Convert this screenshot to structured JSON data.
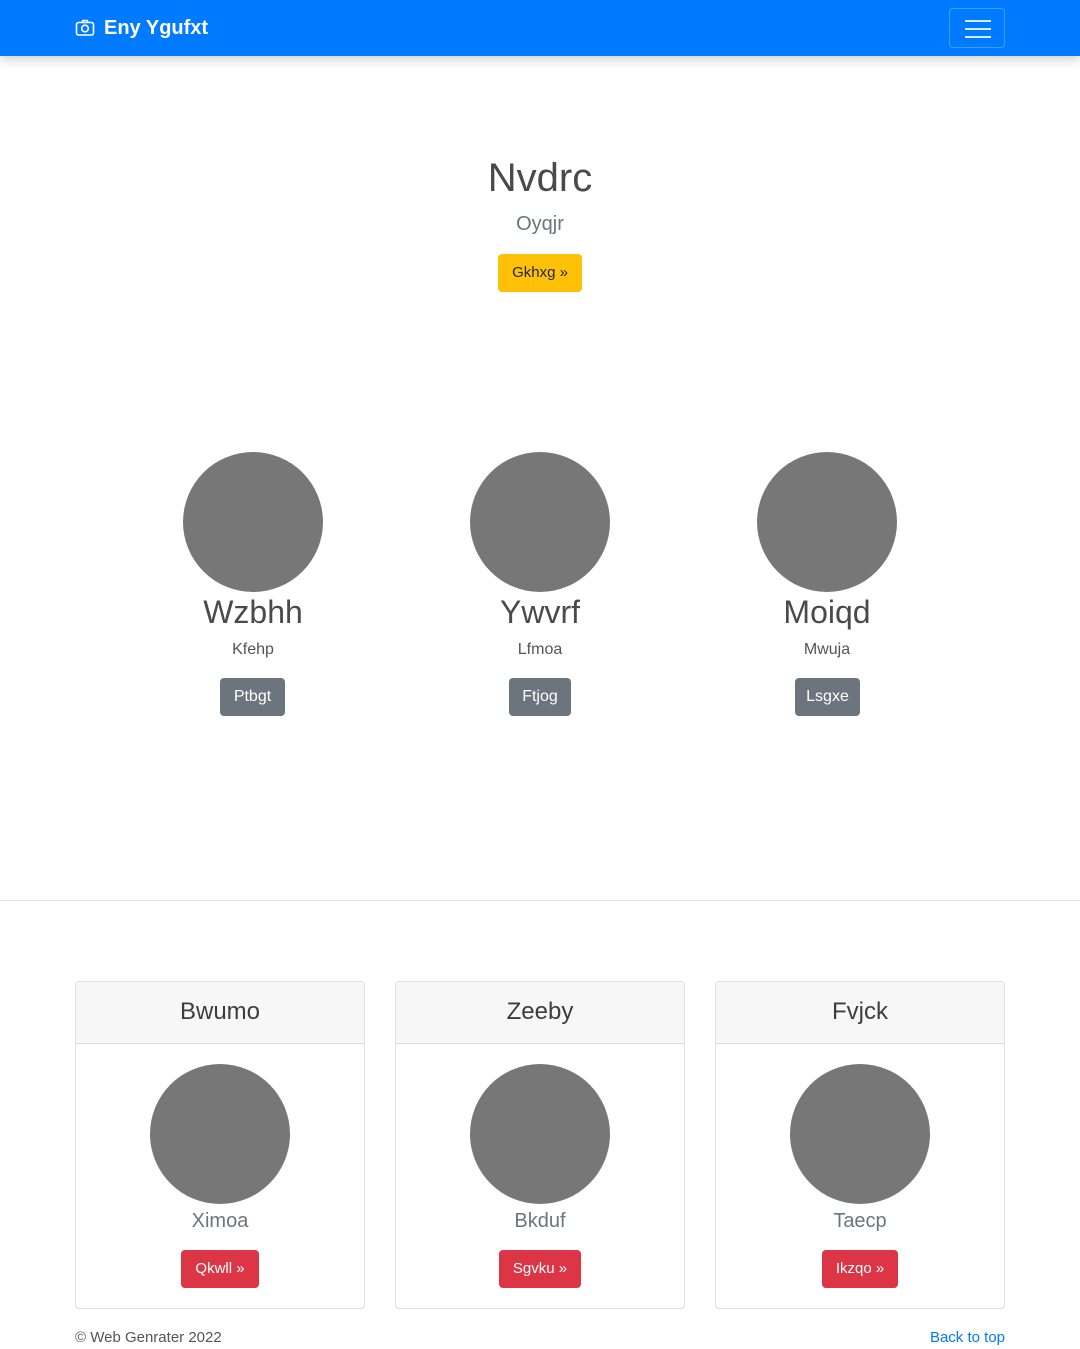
{
  "navbar": {
    "brand_icon": "camera-icon",
    "brand": "Eny Ygufxt",
    "toggler_icon": "hamburger-icon",
    "color": "#007bff"
  },
  "hero": {
    "title": "Nvdrc",
    "lead": "Oyqjr",
    "button": "Gkhxg »"
  },
  "features": [
    {
      "title": "Wzbhh",
      "text": "Kfehp",
      "button": "Ptbgt"
    },
    {
      "title": "Ywvrf",
      "text": "Lfmoa",
      "button": "Ftjog"
    },
    {
      "title": "Moiqd",
      "text": "Mwuja",
      "button": "Lsgxe"
    }
  ],
  "cards": [
    {
      "header": "Bwumo",
      "text": "Ximoa",
      "button": "Qkwll »"
    },
    {
      "header": "Zeeby",
      "text": "Bkduf",
      "button": "Sgvku »"
    },
    {
      "header": "Fvjck",
      "text": "Taecp",
      "button": "Ikzqo »"
    }
  ],
  "footer": {
    "copyright": "© Web Genrater 2022",
    "back_to_top": "Back to top"
  },
  "colors": {
    "warning": "#ffc107",
    "secondary": "#6c757d",
    "danger": "#dc3545",
    "placeholder": "#777777"
  }
}
